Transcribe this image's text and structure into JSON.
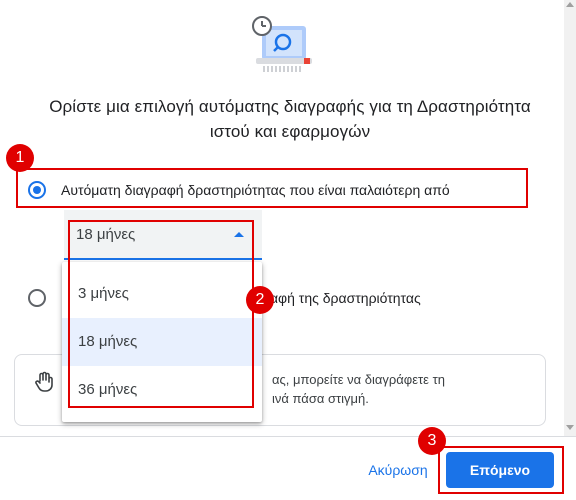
{
  "heading": "Ορίστε μια επιλογή αυτόματης διαγραφής για τη Δραστηριότητα ιστού και εφαρμογών",
  "option_auto": {
    "label": "Αυτόματη διαγραφή δραστηριότητας που είναι παλαιότερη από",
    "selected": true
  },
  "select": {
    "value": "18 μήνες"
  },
  "menu": {
    "items": [
      "3 μήνες",
      "18 μήνες",
      "36 μήνες"
    ],
    "selected_index": 1
  },
  "option_manual": {
    "label": "ραφή της δραστηριότητας",
    "selected": false
  },
  "info": {
    "line1": "ας, μπορείτε να διαγράφετε τη",
    "line2": "ινά πάσα στιγμή."
  },
  "footer": {
    "cancel_label": "Ακύρωση",
    "next_label": "Επόμενο"
  },
  "annotations": {
    "badge1": "1",
    "badge2": "2",
    "badge3": "3"
  },
  "colors": {
    "accent": "#1a73e8",
    "highlight": "#e00000"
  },
  "icons": {
    "hero": "auto-delete-illustration",
    "info": "hand-gesture-icon"
  }
}
